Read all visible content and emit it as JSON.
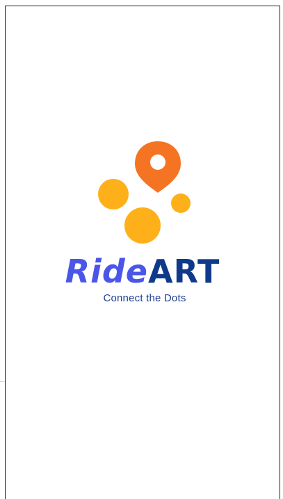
{
  "app": {
    "brand_part1": "Ride",
    "brand_part2": "ART",
    "tagline": "Connect the Dots"
  },
  "colors": {
    "pin": "#F47423",
    "dots": "#FDB019",
    "ride_text": "#4A56E8",
    "art_text": "#0F3A8A",
    "tagline_text": "#1E3F8F"
  },
  "icons": [
    "map-pin-icon",
    "dot-icon"
  ]
}
